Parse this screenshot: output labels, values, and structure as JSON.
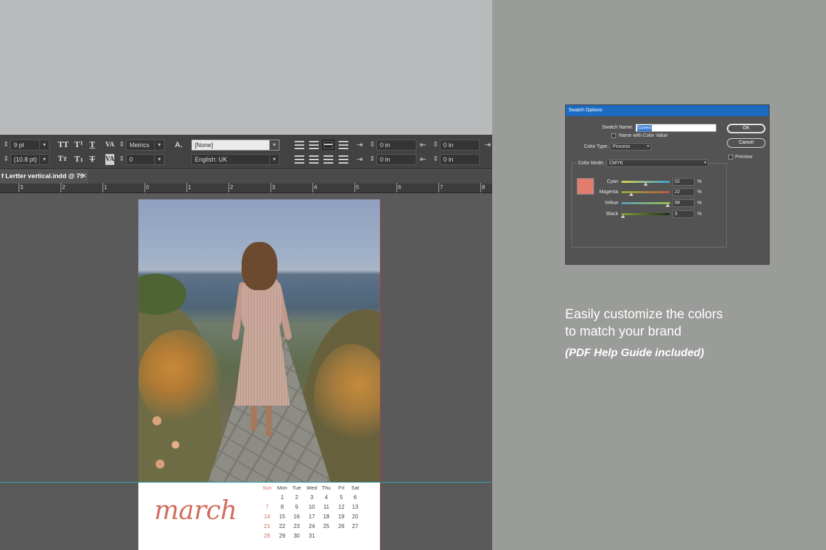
{
  "control_panel": {
    "font_size": "9 pt",
    "leading": "(10.8 pt)",
    "kerning": "Metrics",
    "tracking": "0",
    "char_style": "[None]",
    "language": "English: UK",
    "indent_left": "0 in",
    "indent_right": "0 in",
    "indent_first": "0 in",
    "indent_last": "0 in"
  },
  "document_tab": {
    "title": "f Lertter vertical.indd @ 79",
    "close": "✕"
  },
  "ruler": {
    "labels": [
      "3",
      "2",
      "1",
      "0",
      "1",
      "2",
      "3",
      "4",
      "5",
      "6",
      "7",
      "8"
    ]
  },
  "calendar": {
    "month": "march",
    "headers": [
      "Sun",
      "Mon",
      "Tue",
      "Wed",
      "Thu",
      "Fri",
      "Sat"
    ],
    "weeks": [
      [
        "",
        "1",
        "2",
        "3",
        "4",
        "5",
        "6"
      ],
      [
        "7",
        "8",
        "9",
        "10",
        "11",
        "12",
        "13"
      ],
      [
        "14",
        "15",
        "16",
        "17",
        "18",
        "19",
        "20"
      ],
      [
        "21",
        "22",
        "23",
        "24",
        "25",
        "26",
        "27"
      ],
      [
        "28",
        "29",
        "30",
        "31",
        "",
        "",
        ""
      ]
    ],
    "accent_color": "#d26d5e"
  },
  "dialog": {
    "title": "Swatch Options",
    "swatch_name_label": "Swatch Name:",
    "swatch_name_value": "Green",
    "name_with_color_value_label": "Name with Color Value",
    "color_type_label": "Color Type:",
    "color_type_value": "Process",
    "color_mode_label": "Color Mode:",
    "color_mode_value": "CMYK",
    "ok_label": "OK",
    "cancel_label": "Cancel",
    "preview_label": "Preview",
    "swatch_color": "#e27c6e",
    "channels": [
      {
        "label": "Cyan",
        "value": "52",
        "unit": "%"
      },
      {
        "label": "Magenta",
        "value": "22",
        "unit": "%"
      },
      {
        "label": "Yellow",
        "value": "99",
        "unit": "%"
      },
      {
        "label": "Black",
        "value": "3",
        "unit": "%"
      }
    ]
  },
  "marketing": {
    "line1": "Easily customize the colors",
    "line2": "to match your brand",
    "note": "(PDF Help Guide included)"
  }
}
